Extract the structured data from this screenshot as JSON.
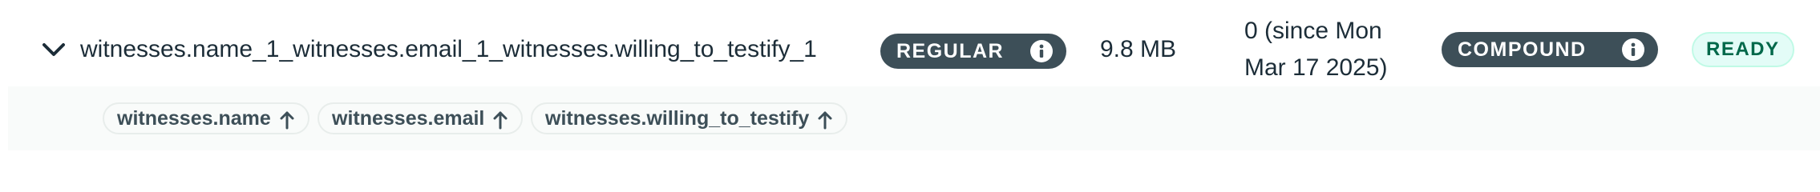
{
  "index": {
    "name": "witnesses.name_1_witnesses.email_1_witnesses.willing_to_testify_1",
    "type_badge": "REGULAR",
    "size": "9.8 MB",
    "usage_line1": "0 (since Mon",
    "usage_line2": "Mar 17 2025)",
    "properties_badge": "COMPOUND",
    "status": "READY",
    "expand_icon": "chevron-down-icon",
    "info_icon": "info-icon"
  },
  "fields": [
    {
      "name": "witnesses.name",
      "direction_icon": "arrow-up-icon"
    },
    {
      "name": "witnesses.email",
      "direction_icon": "arrow-up-icon"
    },
    {
      "name": "witnesses.willing_to_testify",
      "direction_icon": "arrow-up-icon"
    }
  ],
  "colors": {
    "text": "#1c2d38",
    "badge_dark": "#3d4f58",
    "ready_bg": "#e3fcf7",
    "ready_text": "#00684a",
    "fields_bg": "#f9fbfa"
  }
}
